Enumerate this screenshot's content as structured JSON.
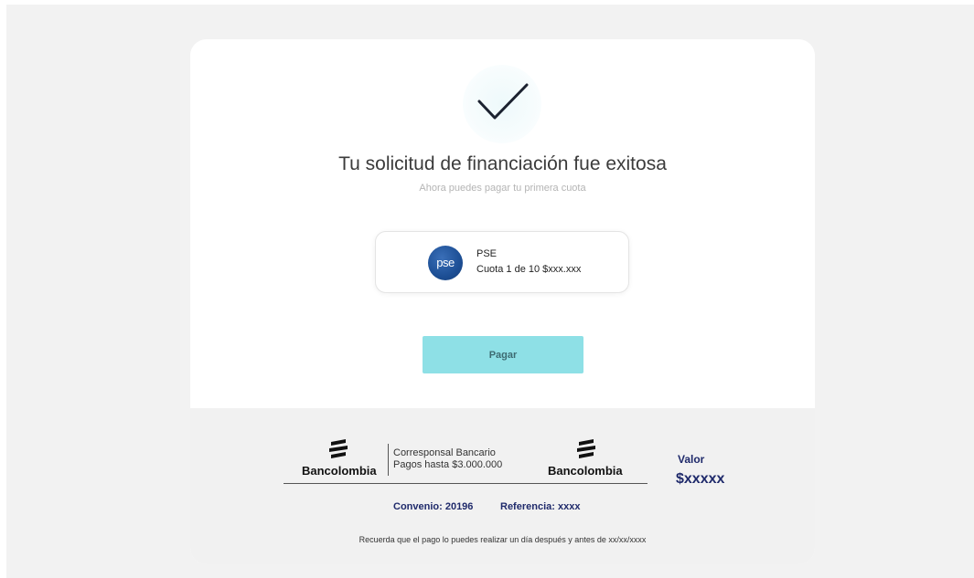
{
  "success": {
    "title": "Tu solicitud de financiación fue exitosa",
    "subtitle": "Ahora puedes pagar tu primera cuota"
  },
  "payment_method": {
    "logo_text": "pse",
    "name": "PSE",
    "installment": "Cuota 1 de 10 $xxx.xxx"
  },
  "actions": {
    "pay_label": "Pagar"
  },
  "voucher": {
    "brand_name": "Bancolombia",
    "correspondent_line1": "Corresponsal Bancario",
    "correspondent_line2": "Pagos hasta $3.000.000",
    "value_label": "Valor",
    "value_amount": "$xxxxx",
    "agreement": "Convenio: 20196",
    "reference": "Referencia: xxxx",
    "note": "Recuerda que el pago lo puedes realizar un día después y antes de xx/xx/xxxx"
  },
  "colors": {
    "accent_button": "#8ee0e6",
    "navy_text": "#1f2a6b",
    "pse_blue": "#1d4f95"
  },
  "icons": {
    "success": "checkmark-icon",
    "brand": "bancolombia-logo-icon"
  }
}
